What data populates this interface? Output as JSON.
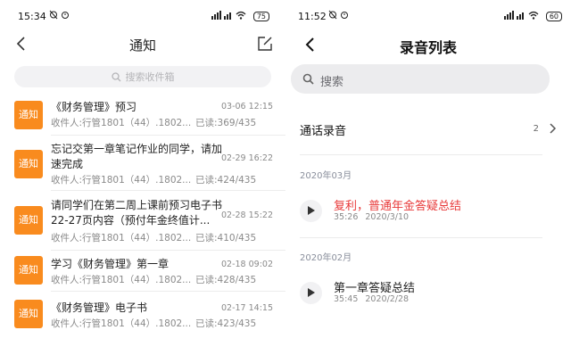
{
  "left": {
    "status": {
      "time": "15:34",
      "battery": "75"
    },
    "title": "通知",
    "search_placeholder": "搜索收件箱",
    "notices": [
      {
        "badge": "通知",
        "title": "《财务管理》预习",
        "date": "03-06 12:15",
        "recipients": "收件人:行管1801（44）.1802...",
        "read": "已读:369/435"
      },
      {
        "badge": "通知",
        "title": "忘记交第一章笔记作业的同学，请加速完成",
        "date": "02-29 16:22",
        "recipients": "收件人:行管1801（44）.1802...",
        "read": "已读:424/435"
      },
      {
        "badge": "通知",
        "title": "请同学们在第二周上课前预习电子书22-27页内容（预付年金终值计...",
        "date": "02-28 15:22",
        "recipients": "收件人:行管1801（44）.1802...",
        "read": "已读:410/435"
      },
      {
        "badge": "通知",
        "title": "学习《财务管理》第一章",
        "date": "02-18 09:02",
        "recipients": "收件人:行管1801（44）.1802...",
        "read": "已读:428/435"
      },
      {
        "badge": "通知",
        "title": "《财务管理》电子书",
        "date": "02-17 14:15",
        "recipients": "收件人:行管1801（44）.1802...",
        "read": "已读:423/435"
      }
    ]
  },
  "right": {
    "status": {
      "time": "11:52",
      "battery": "60"
    },
    "title": "录音列表",
    "search_placeholder": "搜索",
    "call_recording": {
      "label": "通话录音",
      "count": "2"
    },
    "groups": [
      {
        "month": "2020年03月",
        "items": [
          {
            "name": "复利，普通年金答疑总结",
            "duration": "35:26",
            "date": "2020/3/10",
            "highlight": true
          }
        ]
      },
      {
        "month": "2020年02月",
        "items": [
          {
            "name": "第一章答疑总结",
            "duration": "35:45",
            "date": "2020/2/28",
            "highlight": false
          }
        ]
      }
    ]
  },
  "colors": {
    "badge": "#f98b1e",
    "highlight": "#e83a3a"
  }
}
